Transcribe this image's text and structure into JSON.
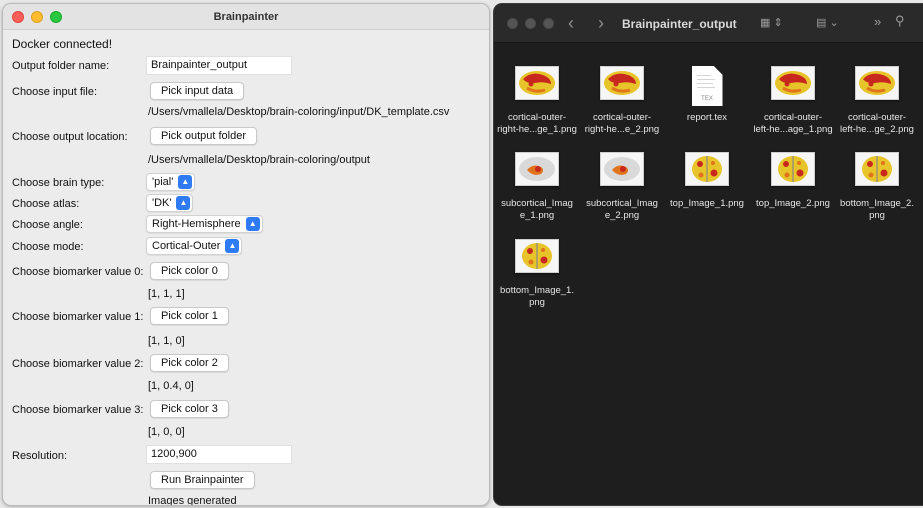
{
  "app": {
    "title": "Brainpainter",
    "status": "Docker connected!",
    "output_folder_label": "Output folder name:",
    "output_folder_value": "Brainpainter_output",
    "input_file_label": "Choose input file:",
    "input_file_button": "Pick input data",
    "input_file_path": "/Users/vmallela/Desktop/brain-coloring/input/DK_template.csv",
    "output_location_label": "Choose output location:",
    "output_location_button": "Pick output folder",
    "output_location_path": "/Users/vmallela/Desktop/brain-coloring/output",
    "brain_type_label": "Choose brain type:",
    "brain_type_value": "'pial'",
    "atlas_label": "Choose atlas:",
    "atlas_value": "'DK'",
    "angle_label": "Choose angle:",
    "angle_value": "Right-Hemisphere",
    "mode_label": "Choose mode:",
    "mode_value": "Cortical-Outer",
    "biomarkers": [
      {
        "label": "Choose biomarker value 0:",
        "button": "Pick color 0",
        "value": "[1, 1, 1]"
      },
      {
        "label": "Choose biomarker value 1:",
        "button": "Pick color 1",
        "value": "[1, 1, 0]"
      },
      {
        "label": "Choose biomarker value 2:",
        "button": "Pick color 2",
        "value": "[1, 0.4, 0]"
      },
      {
        "label": "Choose biomarker value 3:",
        "button": "Pick color 3",
        "value": "[1, 0, 0]"
      }
    ],
    "resolution_label": "Resolution:",
    "resolution_value": "1200,900",
    "run_button": "Run Brainpainter",
    "result_text": "Images generated"
  },
  "finder": {
    "title": "Brainpainter_output",
    "toolbar_icons": [
      "back-icon",
      "forward-icon",
      "icon-view-icon",
      "group-icon",
      "more-icon",
      "search-icon"
    ],
    "files": [
      {
        "name": "cortical-outer-\nright-he...ge_1.png",
        "kind": "cortical"
      },
      {
        "name": "cortical-outer-\nright-he...e_2.png",
        "kind": "cortical"
      },
      {
        "name": "report.tex",
        "kind": "tex"
      },
      {
        "name": "cortical-outer-\nleft-he...age_1.png",
        "kind": "cortical"
      },
      {
        "name": "cortical-outer-\nleft-he...ge_2.png",
        "kind": "cortical"
      },
      {
        "name": "subcortical_Imag\ne_1.png",
        "kind": "subcortical"
      },
      {
        "name": "subcortical_Imag\ne_2.png",
        "kind": "subcortical"
      },
      {
        "name": "top_Image_1.png",
        "kind": "top"
      },
      {
        "name": "top_Image_2.png",
        "kind": "top"
      },
      {
        "name": "bottom_Image_2.\npng",
        "kind": "top"
      },
      {
        "name": "bottom_Image_1.\npng",
        "kind": "top"
      }
    ],
    "tex_tag": "TEX"
  },
  "colors": {
    "accent": "#2f7bf6",
    "brain_yellow": "#e7c42a",
    "brain_red": "#c8281e",
    "brain_orange": "#e0731c"
  }
}
